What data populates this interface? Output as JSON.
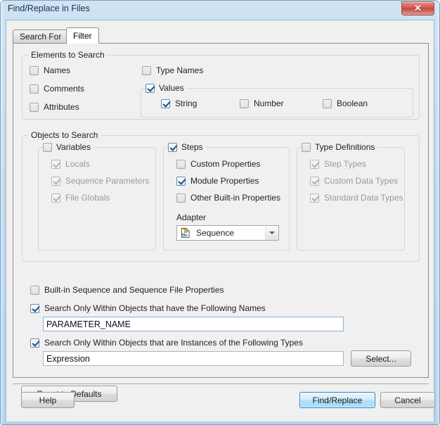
{
  "window": {
    "title": "Find/Replace in Files",
    "close_label": "✕",
    "close_icon": "close-icon"
  },
  "tabs": [
    {
      "label": "Search For",
      "active": false
    },
    {
      "label": "Filter",
      "active": true
    }
  ],
  "elements_group": {
    "title": "Elements to Search",
    "left_items": [
      {
        "label": "Names",
        "checked": false,
        "enabled": true
      },
      {
        "label": "Comments",
        "checked": false,
        "enabled": true
      },
      {
        "label": "Attributes",
        "checked": false,
        "enabled": true
      }
    ],
    "type_names": {
      "label": "Type Names",
      "checked": false,
      "enabled": true
    },
    "values_group": {
      "title": "Values",
      "checked": true,
      "items": [
        {
          "label": "String",
          "checked": true,
          "enabled": true
        },
        {
          "label": "Number",
          "checked": false,
          "enabled": true
        },
        {
          "label": "Boolean",
          "checked": false,
          "enabled": true
        }
      ]
    }
  },
  "objects_group": {
    "title": "Objects to Search",
    "variables": {
      "title": "Variables",
      "checked": false,
      "enabled": true,
      "items": [
        {
          "label": "Locals",
          "checked": true,
          "enabled": false
        },
        {
          "label": "Sequence Parameters",
          "checked": true,
          "enabled": false
        },
        {
          "label": "File Globals",
          "checked": true,
          "enabled": false
        }
      ]
    },
    "steps": {
      "title": "Steps",
      "checked": true,
      "enabled": true,
      "items": [
        {
          "label": "Custom Properties",
          "checked": false,
          "enabled": true
        },
        {
          "label": "Module Properties",
          "checked": true,
          "enabled": true
        },
        {
          "label": "Other Built-in Properties",
          "checked": false,
          "enabled": true
        }
      ],
      "adapter_label": "Adapter",
      "adapter_value": "Sequence",
      "adapter_icon": "sequence-file-icon",
      "adapter_arrow_icon": "chevron-down-icon"
    },
    "type_definitions": {
      "title": "Type Definitions",
      "checked": false,
      "enabled": true,
      "items": [
        {
          "label": "Step Types",
          "checked": true,
          "enabled": false
        },
        {
          "label": "Custom Data Types",
          "checked": true,
          "enabled": false
        },
        {
          "label": "Standard Data Types",
          "checked": true,
          "enabled": false
        }
      ]
    }
  },
  "options": {
    "builtin_props": {
      "label": "Built-in Sequence and Sequence File Properties",
      "checked": false
    },
    "names_filter": {
      "label": "Search Only Within Objects that have the Following Names",
      "checked": true,
      "value": "PARAMETER_NAME",
      "placeholder": ""
    },
    "types_filter": {
      "label": "Search Only Within Objects that are Instances of the Following Types",
      "checked": true,
      "value": "Expression",
      "placeholder": "",
      "select_button": "Select..."
    }
  },
  "buttons": {
    "reset": "Reset to Defaults",
    "help": "Help",
    "find_replace": "Find/Replace",
    "cancel": "Cancel"
  },
  "colors": {
    "accent_blue": "#2e82c4",
    "frame_blue": "#b3d2ea",
    "close_red": "#c2483c",
    "disabled_gray": "#9a9a9a"
  }
}
